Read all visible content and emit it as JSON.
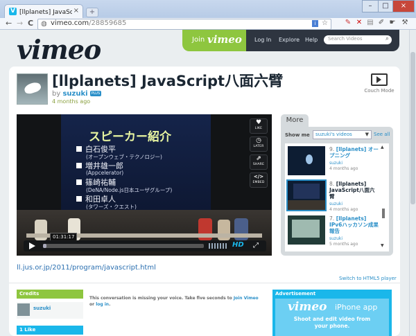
{
  "browser": {
    "tab_title": "[llplanets] JavaScript八面",
    "tab_close": "×",
    "new_tab": "+",
    "url_domain": "vimeo.com",
    "url_path": "/28859685",
    "nav_back": "←",
    "nav_forward": "→",
    "nav_reload": "C",
    "min": "–",
    "max": "□",
    "close": "×",
    "favicon": "V"
  },
  "header": {
    "logo": "vimeo",
    "join_label": "Join",
    "join_brand": "vimeo",
    "nav": [
      "Log In",
      "Explore",
      "Help"
    ],
    "search_placeholder": "Search Videos"
  },
  "video": {
    "title": "[llplanets] JavaScript八面六臂",
    "by_label": "by",
    "user": "suzuki",
    "plus_badge": "PLUS",
    "ago": "4 months ago",
    "couch_mode": "Couch Mode",
    "slide": {
      "title": "スピーカー紹介",
      "lines": [
        {
          "name": "白石俊平",
          "sub": "(オープンウェブ・テクノロジー)"
        },
        {
          "name": "増井雄一郎",
          "sub": "(Appcelerator)"
        },
        {
          "name": "篠崎祐輔",
          "sub": "(DeNA/Node.js日本ユーザグループ)"
        },
        {
          "name": "和田卓人",
          "sub": "(タワーズ・クエスト)"
        }
      ]
    },
    "side_buttons": [
      {
        "icon": "heart-icon",
        "glyph": "♥",
        "label": "LIKE"
      },
      {
        "icon": "clock-icon",
        "glyph": "◷",
        "label": "LATER"
      },
      {
        "icon": "share-icon",
        "glyph": "⇗",
        "label": "SHARE"
      },
      {
        "icon": "embed-icon",
        "glyph": "</>",
        "label": "EMBED"
      }
    ],
    "time": "01:31:17",
    "progress": 0.02,
    "hd": "HD",
    "link": "ll.jus.or.jp/2011/program/javascript.html",
    "switch_html5": "Switch to HTML5 player"
  },
  "more": {
    "tab": "More",
    "show_me": "Show me",
    "select_value": "suzuki's videos",
    "see_all": "See all",
    "items": [
      {
        "num": "9.",
        "title": "[llplanets] オープニング",
        "user": "suzuki",
        "ago": "4 months ago"
      },
      {
        "num": "8.",
        "title": "[llplanets] JavaScript八面六臂",
        "user": "suzuki",
        "ago": "4 months ago"
      },
      {
        "num": "7.",
        "title": "[llplanets] IPv6ハッカソン成果報告",
        "user": "suzuki",
        "ago": "5 months ago"
      }
    ]
  },
  "lower": {
    "credits": "Credits",
    "credit_user": "suzuki",
    "like_header": "1 Like",
    "missing_text": "This conversation is missing your voice. Take five seconds to",
    "join_link": "Join Vimeo",
    "or": "or",
    "login_link": "log in",
    "ad_header": "Advertisement",
    "ad_brand": "vimeo",
    "ad_app": "iPhone app",
    "ad_line1": "Shoot and edit video from",
    "ad_line2": "your phone."
  }
}
